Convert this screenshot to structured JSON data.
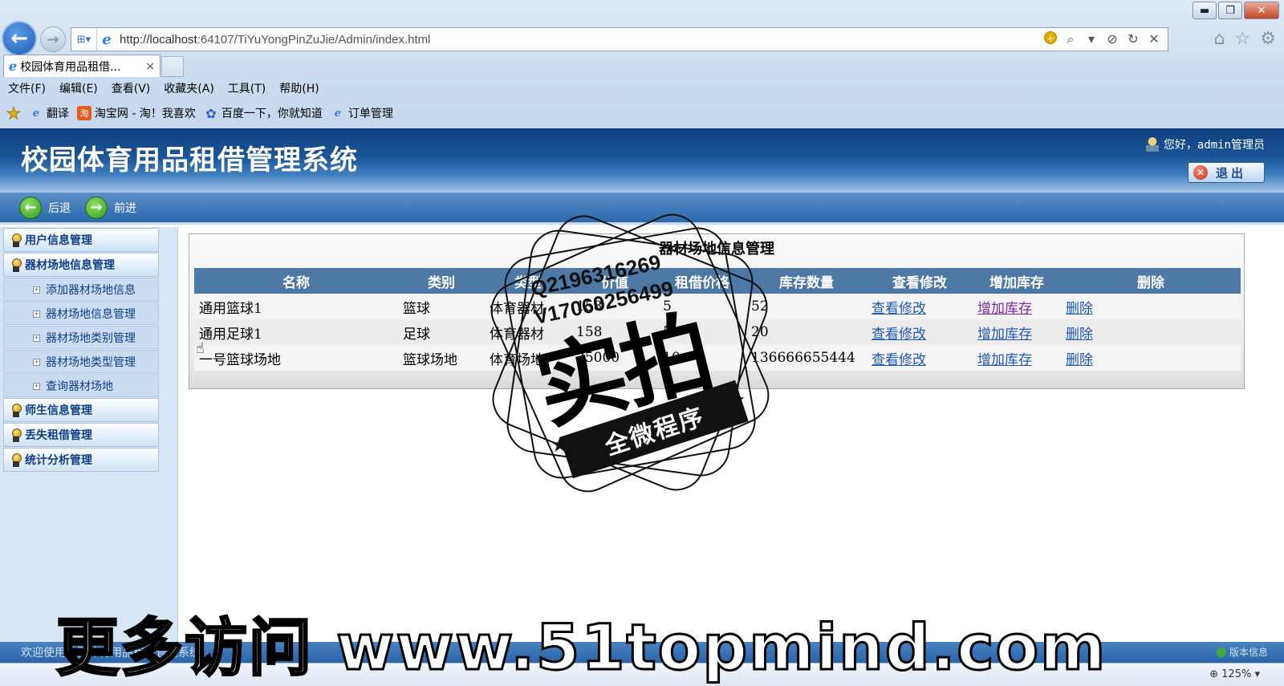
{
  "browser": {
    "url_host": "http://localhost",
    "url_rest": ":64107/TiYuYongPinZuJie/Admin/index.html",
    "tab_title": "校园体育用品租借...",
    "tab_close": "×",
    "window_buttons": {
      "minimize": "▬",
      "restore": "❐",
      "close": "✕"
    },
    "menu": [
      "文件(F)",
      "编辑(E)",
      "查看(V)",
      "收藏夹(A)",
      "工具(T)",
      "帮助(H)"
    ],
    "favorites": [
      {
        "label": "翻译",
        "icon": "ie-icon"
      },
      {
        "label": "淘宝网 - 淘！我喜欢",
        "icon": "taobao-icon"
      },
      {
        "label": "百度一下，你就知道",
        "icon": "baidu-paw-icon"
      },
      {
        "label": "订单管理",
        "icon": "ie-icon"
      }
    ],
    "zoom": "125%"
  },
  "header": {
    "title": "校园体育用品租借管理系统",
    "greeting": "您好，admin管理员",
    "logout_label": "退出"
  },
  "subnav": {
    "back_label": "后退",
    "forward_label": "前进"
  },
  "sidebar": {
    "groups": [
      {
        "label": "用户信息管理"
      },
      {
        "label": "器材场地信息管理"
      }
    ],
    "subitems": [
      "添加器材场地信息",
      "器材场地信息管理",
      "器材场地类别管理",
      "器材场地类型管理",
      "查询器材场地"
    ],
    "groups_after": [
      {
        "label": "师生信息管理"
      },
      {
        "label": "丢失租借管理"
      },
      {
        "label": "统计分析管理"
      }
    ]
  },
  "main": {
    "panel_title": "器材场地信息管理",
    "columns": [
      "名称",
      "类别",
      "类型",
      "价值",
      "租借价格",
      "库存数量",
      "查看修改",
      "增加库存",
      "删除"
    ],
    "rows": [
      {
        "name": "通用篮球1",
        "category": "篮球",
        "type": "体育器材",
        "value": "158",
        "price": "5",
        "stock": "52",
        "view": "查看修改",
        "add": "增加库存",
        "del": "删除"
      },
      {
        "name": "通用足球1",
        "category": "足球",
        "type": "体育器材",
        "value": "158",
        "price": "5",
        "stock": "20",
        "view": "查看修改",
        "add": "增加库存",
        "del": "删除"
      },
      {
        "name": "一号篮球场地",
        "category": "篮球场地",
        "type": "体育场地",
        "value": "35000",
        "price": "10",
        "stock": "136666655444",
        "view": "查看修改",
        "add": "增加库存",
        "del": "删除"
      }
    ]
  },
  "footer": {
    "welcome": "欢迎使用校园体育用品租借管理系统",
    "version": "版本信息"
  },
  "watermark": {
    "qq": "Q2196316269",
    "wechat": "V17060256499",
    "big": "实拍",
    "ribbon": "全微程序",
    "banner": "更多访问 www.51topmind.com"
  },
  "colors": {
    "header_dark": "#0e3f7c",
    "grid_header": "#4e78a6",
    "link": "#1f5ab5",
    "visited_link": "#7a2a9c"
  }
}
